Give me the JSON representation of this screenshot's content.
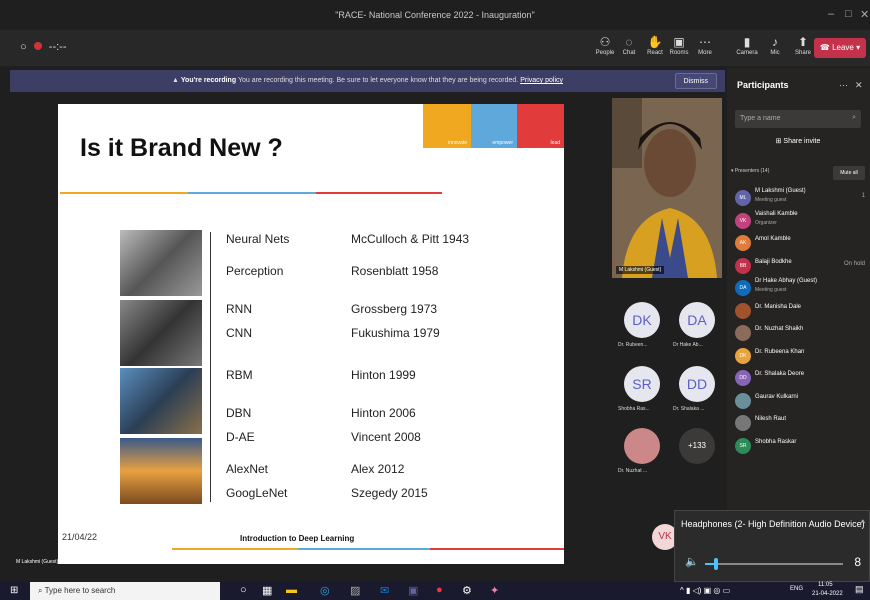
{
  "window": {
    "title": "\"RACE- National Conference 2022 - Inauguration\"",
    "min": "–",
    "max": "□",
    "close": "✕"
  },
  "toolbar": {
    "timer": "--:--",
    "buttons": [
      {
        "label": "People",
        "icon": "people-icon",
        "glyph": "⚇"
      },
      {
        "label": "Chat",
        "icon": "chat-icon",
        "glyph": "◌"
      },
      {
        "label": "React",
        "icon": "react-icon",
        "glyph": "✋"
      },
      {
        "label": "Rooms",
        "icon": "rooms-icon",
        "glyph": "▣"
      },
      {
        "label": "More",
        "icon": "more-icon",
        "glyph": "⋯"
      },
      {
        "label": "Camera",
        "icon": "camera-icon",
        "glyph": "▮"
      },
      {
        "label": "Mic",
        "icon": "mic-icon",
        "glyph": "♪"
      },
      {
        "label": "Share",
        "icon": "share-icon",
        "glyph": "⬆"
      }
    ],
    "leave": "Leave"
  },
  "banner": {
    "strong": "You're recording",
    "text": "You are recording this meeting. Be sure to let everyone know that they are being recorded.",
    "link": "Privacy policy",
    "dismiss": "Dismiss"
  },
  "slide": {
    "title": "Is it Brand New ?",
    "blocks": [
      "innovate",
      "empower",
      "lead"
    ],
    "rows": [
      {
        "left": "Neural Nets",
        "right": "McCulloch & Pitt 1943"
      },
      {
        "left": "Perception",
        "right": "Rosenblatt 1958"
      },
      {
        "left": "RNN",
        "right": "Grossberg 1973"
      },
      {
        "left": "CNN",
        "right": "Fukushima 1979"
      },
      {
        "left": "RBM",
        "right": "Hinton 1999"
      },
      {
        "left": "DBN",
        "right": "Hinton 2006"
      },
      {
        "left": "D-AE",
        "right": "Vincent 2008"
      },
      {
        "left": "AlexNet",
        "right": "Alex 2012"
      },
      {
        "left": "GoogLeNet",
        "right": "Szegedy 2015"
      }
    ],
    "date": "21/04/22",
    "footer": "Introduction to Deep Learning"
  },
  "stage": {
    "presenter": "M Lakshmi (Guest)"
  },
  "video": {
    "name": "M Lakshmi (Guest)"
  },
  "tiles": [
    {
      "init": "DK",
      "name": "Dr. Rubeen..."
    },
    {
      "init": "DA",
      "name": "Dr Hake Ab..."
    },
    {
      "init": "SR",
      "name": "Shobha Ras..."
    },
    {
      "init": "DD",
      "name": "Dr. Shalaka ..."
    },
    {
      "init": "",
      "name": "Dr. Nuzhat ..."
    },
    {
      "init": "+133",
      "name": ""
    }
  ],
  "participants": {
    "title": "Participants",
    "search_placeholder": "Type a name",
    "share_invite": "Share invite",
    "section": "Presenters (14)",
    "mute_all": "Mute all",
    "list": [
      {
        "init": "ML",
        "name": "M Lakshmi (Guest)",
        "role": "Meeting guest",
        "status": "1",
        "color": "#6264a7"
      },
      {
        "init": "VK",
        "name": "Vaishali Kamble",
        "role": "Organizer",
        "status": "",
        "color": "#c3427e"
      },
      {
        "init": "AK",
        "name": "Amol Kamble",
        "role": "",
        "status": "",
        "color": "#e07b39"
      },
      {
        "init": "BB",
        "name": "Balaji Bodkhe",
        "role": "",
        "status": "On hold",
        "color": "#c4314b"
      },
      {
        "init": "DA",
        "name": "Dr Hake Abhay (Guest)",
        "role": "Meeting guest",
        "status": "",
        "color": "#0f6cbd"
      },
      {
        "init": "",
        "name": "Dr. Manisha Dale",
        "role": "",
        "status": "",
        "color": "#a0522d"
      },
      {
        "init": "",
        "name": "Dr. Nuzhat Shaikh",
        "role": "",
        "status": "",
        "color": "#8b6b5a"
      },
      {
        "init": "DK",
        "name": "Dr. Rubeena Khan",
        "role": "",
        "status": "",
        "color": "#e8a33d"
      },
      {
        "init": "DD",
        "name": "Dr. Shalaka Deore",
        "role": "",
        "status": "",
        "color": "#8764b8"
      },
      {
        "init": "",
        "name": "Gaurav Kulkarni",
        "role": "",
        "status": "",
        "color": "#6b8e9b"
      },
      {
        "init": "",
        "name": "Nilesh Raut",
        "role": "",
        "status": "",
        "color": "#777"
      },
      {
        "init": "SR",
        "name": "Shobha Raskar",
        "role": "",
        "status": "",
        "color": "#2e8b57"
      }
    ]
  },
  "volume": {
    "device": "Headphones (2- High Definition Audio Device)",
    "level": "8",
    "fraction": 0.08
  },
  "vk": "VK",
  "taskbar": {
    "search": "Type here to search",
    "time": "11:05",
    "date": "21-04-2022",
    "lang": "ENG"
  }
}
